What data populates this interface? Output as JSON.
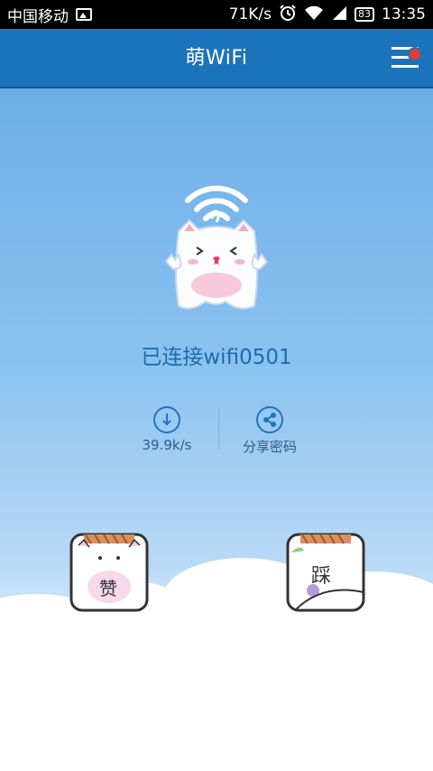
{
  "status_bar": {
    "carrier": "中国移动",
    "network_speed": "71K/s",
    "battery": "83",
    "time": "13:35"
  },
  "app_bar": {
    "title": "萌WiFi"
  },
  "main": {
    "connection_status": "已连接wifi0501",
    "speed_value": "39.9k/s",
    "share_label": "分享密码"
  },
  "cards": {
    "like_label": "赞",
    "stomp_label": "踩"
  },
  "colors": {
    "app_bar": "#1b73bb",
    "accent_blue": "#1f74c0",
    "status_text": "#1e6aad",
    "notification_dot": "#e53935"
  },
  "icons": {
    "menu": "menu-icon",
    "speed": "speed-gauge-icon",
    "share": "share-icon"
  }
}
